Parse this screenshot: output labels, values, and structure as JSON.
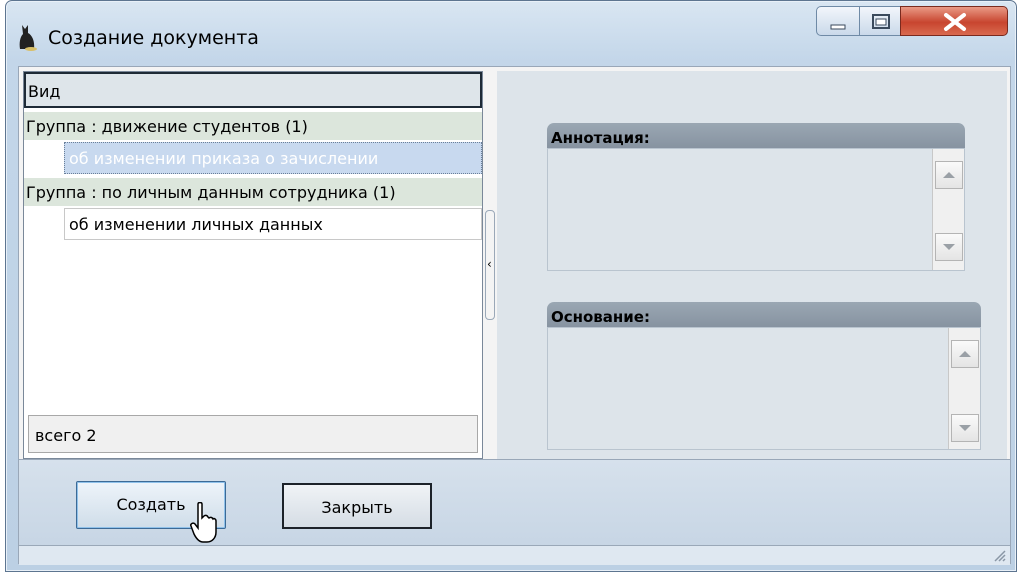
{
  "window": {
    "title": "Создание документа",
    "icon": "cat-silhouette-icon"
  },
  "list": {
    "header": "Вид",
    "groups": [
      {
        "label": "Группа : движение студентов (1)",
        "items": [
          "об изменении приказа о зачислении"
        ]
      },
      {
        "label": "Группа : по личным данным сотрудника (1)",
        "items": [
          "об изменении личных данных"
        ]
      }
    ],
    "total": "всего 2"
  },
  "fields": {
    "annotation_label": "Аннотация:",
    "basis_label": "Основание:"
  },
  "buttons": {
    "create": "Создать",
    "close": "Закрыть"
  },
  "colors": {
    "selection": "#c8d9ef",
    "close_button": "#c8452f",
    "field_header": "#8692a0"
  }
}
